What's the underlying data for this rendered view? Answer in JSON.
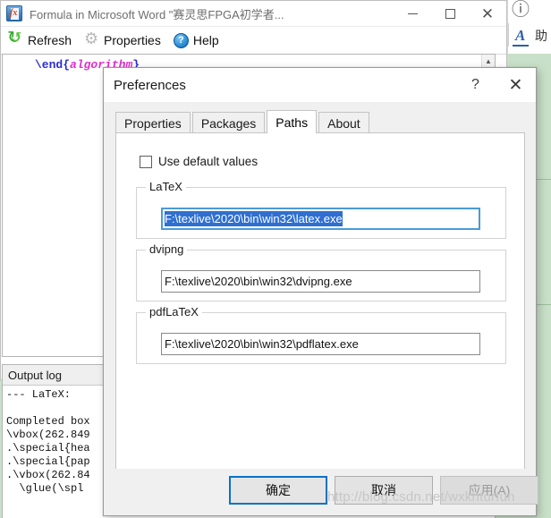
{
  "host_window": {
    "title": "Formula in Microsoft Word \"赛灵思FPGA初学者...",
    "app_icon": "formula-app-icon",
    "caption": {
      "minimize": "minimize-icon",
      "maximize": "maximize-icon",
      "close": "close-icon"
    },
    "toolbar": {
      "items": [
        {
          "label": "Refresh",
          "icon": "refresh-icon"
        },
        {
          "label": "Properties",
          "icon": "gear-icon"
        },
        {
          "label": "Help",
          "icon": "help-circle-icon"
        }
      ]
    },
    "editor": {
      "code_command": "\\end",
      "code_open_brace": "{",
      "code_argument": "algorithm",
      "code_close_brace": "}",
      "scroll_up": "scroll-up-arrow",
      "scroll_down": "scroll-down-arrow"
    },
    "output_log": {
      "header": "Output log",
      "body": "--- LaTeX:\n\nCompleted box\n\\vbox(262.849\n.\\special{hea\n.\\special{pap\n.\\vbox(262.84\n  \\glue(\\spl"
    },
    "right_sliver": {
      "help_icon": "help-circle-icon",
      "letter_a": "A",
      "cn_label": "助"
    }
  },
  "dialog": {
    "title": "Preferences",
    "caption": {
      "help": "?",
      "close": "✕"
    },
    "tabs": [
      {
        "label": "Properties",
        "selected": false
      },
      {
        "label": "Packages",
        "selected": false
      },
      {
        "label": "Paths",
        "selected": true
      },
      {
        "label": "About",
        "selected": false
      }
    ],
    "checkbox": {
      "label": "Use default values",
      "checked": false
    },
    "groups": [
      {
        "title": "LaTeX",
        "value": "F:\\texlive\\2020\\bin\\win32\\latex.exe",
        "focused": true,
        "selected": true
      },
      {
        "title": "dvipng",
        "value": "F:\\texlive\\2020\\bin\\win32\\dvipng.exe",
        "focused": false,
        "selected": false
      },
      {
        "title": "pdfLaTeX",
        "value": "F:\\texlive\\2020\\bin\\win32\\pdflatex.exe",
        "focused": false,
        "selected": false
      }
    ],
    "buttons": {
      "ok": "确定",
      "cancel": "取消",
      "apply": "应用(A)"
    }
  },
  "watermark": {
    "text": "http://blog.csdn.net/wxkhturfun",
    "secondary": ""
  },
  "colors": {
    "accent": "#0a72c8",
    "selection": "#2f6fd0",
    "dialog_bg": "#f0f0f0",
    "excel_green": "#c9e0c8"
  }
}
